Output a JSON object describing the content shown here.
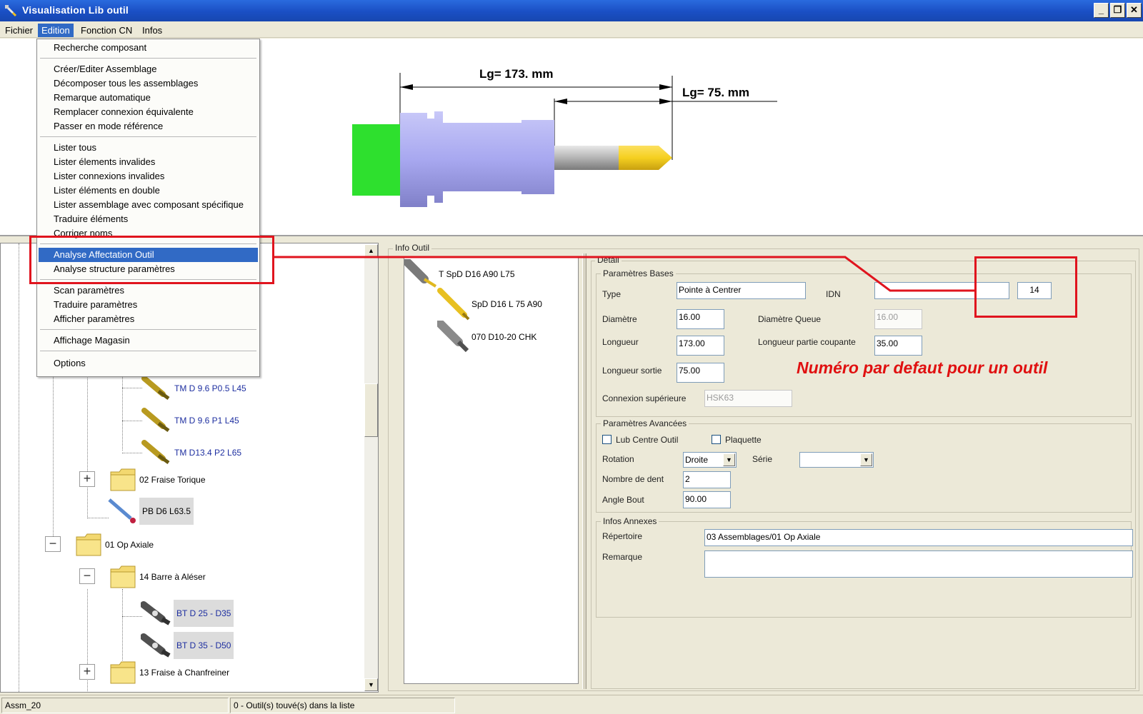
{
  "window": {
    "title": "Visualisation Lib outil",
    "minimize": "_",
    "restore": "❐",
    "close": "✕"
  },
  "menubar": {
    "items": [
      "Fichier",
      "Edition",
      "Fonction CN",
      "Infos"
    ],
    "active": "Edition"
  },
  "edition_menu": {
    "items": [
      "Recherche composant",
      "Créer/Editer Assemblage",
      "Décomposer tous les assemblages",
      "Remarque automatique",
      "Remplacer connexion équivalente",
      "Passer en mode référence",
      "Lister tous",
      "Lister élements invalides",
      "Lister connexions invalides",
      "Lister éléments en double",
      "Lister assemblage avec composant spécifique",
      "Traduire éléments",
      "Corriger noms",
      "Analyse Affectation Outil",
      "Analyse structure paramètres",
      "Scan paramètres",
      "Traduire paramètres",
      "Afficher paramètres",
      "Affichage Magasin",
      "Options"
    ],
    "highlighted": "Analyse Affectation Outil"
  },
  "preview": {
    "total_length_label": "Lg=  173. mm",
    "output_length_label": "Lg=  75. mm",
    "colors": {
      "holder_green": "#2ee02e",
      "body_lavender": "#a8a8f0",
      "tip_yellow": "#f5d020",
      "shank_gray": "#b4b4b4"
    }
  },
  "tree": {
    "nodes": [
      {
        "label": "TM D 9.6 P0.5 L45",
        "style": "blue"
      },
      {
        "label": "TM D 9.6 P1   L45",
        "style": "blue"
      },
      {
        "label": "TM D13.4 P2   L65",
        "style": "blue"
      },
      {
        "label": "02 Fraise Torique",
        "style": "normal"
      },
      {
        "label": "PB D6 L63.5",
        "style": "sel"
      },
      {
        "label": "01 Op Axiale",
        "style": "normal"
      },
      {
        "label": "14 Barre à Aléser",
        "style": "normal"
      },
      {
        "label": "BT D 25 - D35",
        "style": "blue-sel"
      },
      {
        "label": "BT D 35 - D50",
        "style": "blue-sel"
      },
      {
        "label": "13 Fraise à Chanfreiner",
        "style": "normal"
      }
    ]
  },
  "info_outil": {
    "title": "Info Outil",
    "components": [
      "T SpD D16 A90 L75",
      "SpD D16 L 75 A90",
      "070 D10-20  CHK"
    ]
  },
  "detail": {
    "title": "Detail",
    "bases": {
      "title": "Paramètres Bases",
      "type_label": "Type",
      "type_value": "Pointe à Centrer",
      "idn_label": "IDN",
      "idn_value": "",
      "idn_number": "14",
      "diametre_label": "Diamètre",
      "diametre_value": "16.00",
      "diametre_queue_label": "Diamètre Queue",
      "diametre_queue_value": "16.00",
      "longueur_label": "Longueur",
      "longueur_value": "173.00",
      "longueur_coupante_label": "Longueur partie coupante",
      "longueur_coupante_value": "35.00",
      "longueur_sortie_label": "Longueur sortie",
      "longueur_sortie_value": "75.00",
      "connexion_label": "Connexion supérieure",
      "connexion_value": "HSK63"
    },
    "avancees": {
      "title": "Paramètres Avancées",
      "lub_label": "Lub Centre Outil",
      "plaquette_label": "Plaquette",
      "rotation_label": "Rotation",
      "rotation_value": "Droite",
      "serie_label": "Série",
      "serie_value": "",
      "dents_label": "Nombre de dent",
      "dents_value": "2",
      "angle_label": "Angle Bout",
      "angle_value": "90.00"
    },
    "annexes": {
      "title": "Infos Annexes",
      "repertoire_label": "Répertoire",
      "repertoire_value": "03 Assemblages/01 Op Axiale",
      "remarque_label": "Remarque",
      "remarque_value": ""
    }
  },
  "annotation": {
    "text": "Numéro par defaut pour un outil",
    "color": "#e01010"
  },
  "statusbar": {
    "left": "Assm_20",
    "right": "0 - Outil(s) touvé(s) dans la liste"
  }
}
